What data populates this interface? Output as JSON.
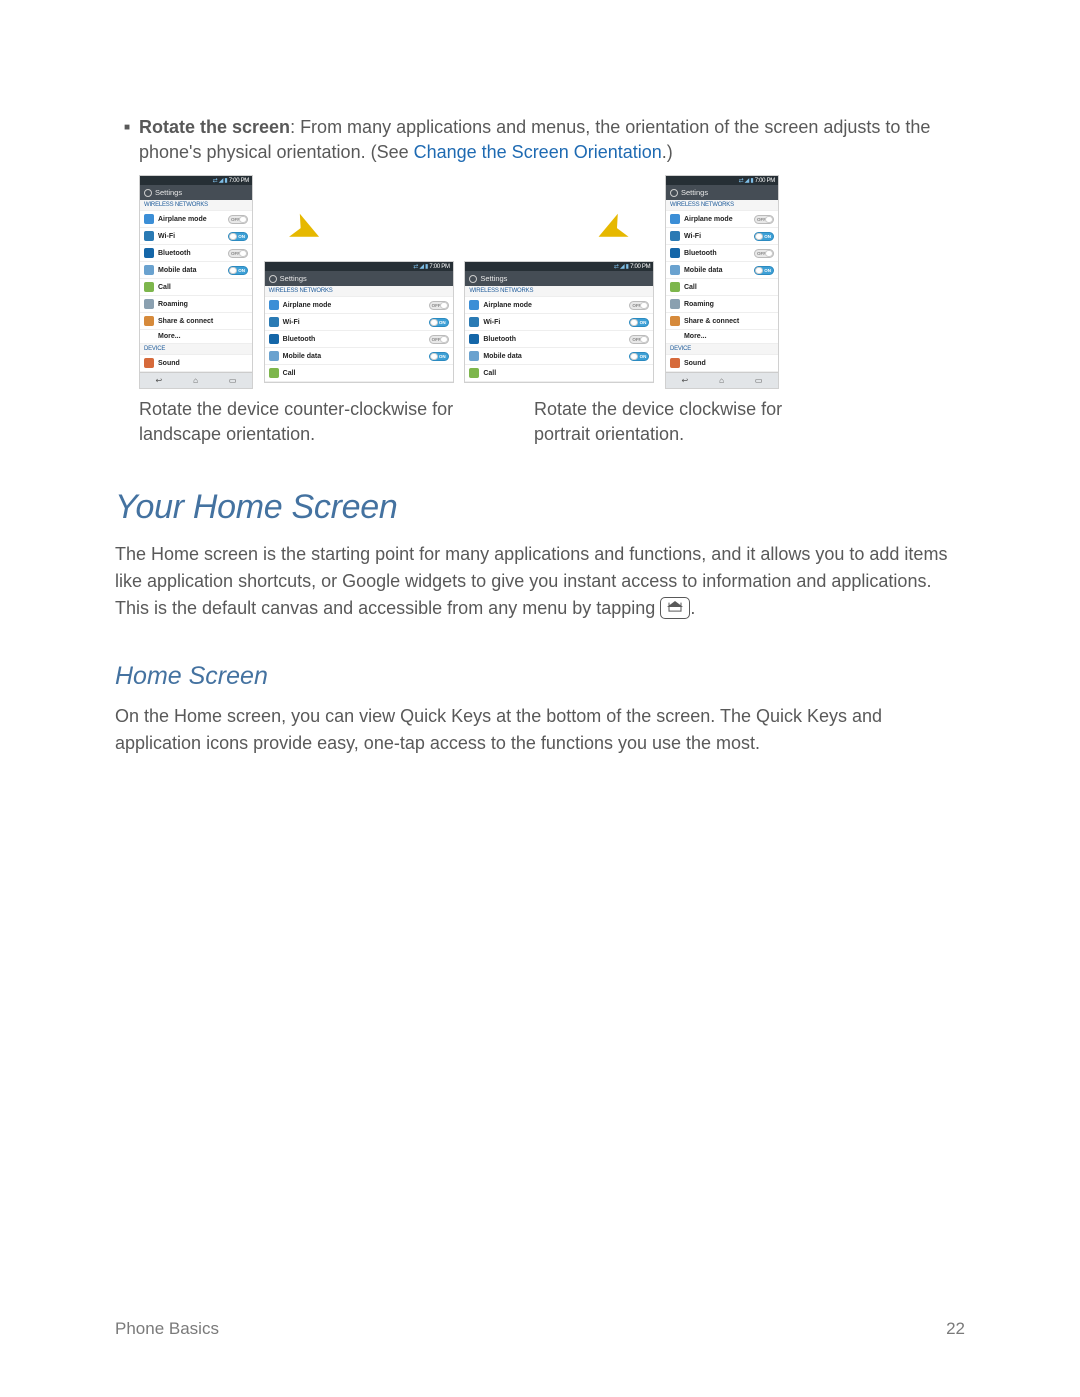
{
  "bullet": {
    "lead": "Rotate the screen",
    "rest_1": ": From many applications and menus, the orientation of the screen adjusts to the phone's physical orientation. (See ",
    "link": "Change the Screen Orientation",
    "rest_2": ".)"
  },
  "phone": {
    "time": "7:00 PM",
    "title": "Settings",
    "section_wireless": "WIRELESS NETWORKS",
    "section_device": "DEVICE",
    "rows": {
      "airplane": "Airplane mode",
      "wifi": "Wi-Fi",
      "bluetooth": "Bluetooth",
      "mobile": "Mobile data",
      "call": "Call",
      "roaming": "Roaming",
      "share": "Share & connect",
      "more": "More...",
      "sound": "Sound"
    },
    "toggle": {
      "airplane": "off",
      "wifi": "on",
      "bluetooth": "off",
      "mobile": "on"
    }
  },
  "captions": {
    "left": "Rotate the device counter-clockwise for landscape orientation.",
    "right": "Rotate the device clockwise for portrait orientation."
  },
  "heading_home_screen": "Your Home Screen",
  "para_home_1a": "The Home screen is the starting point for many applications and functions, and it allows you to add items like application shortcuts, or Google widgets to give you instant access to information and applications. This is the default canvas and accessible from any menu by tapping ",
  "para_home_1b": ".",
  "heading_home_sub": "Home Screen",
  "para_home_2": "On the Home screen, you can view Quick Keys at the bottom of the screen. The Quick Keys and application icons provide easy, one-tap access to the functions you use the most.",
  "footer": {
    "section": "Phone Basics",
    "page": "22"
  }
}
